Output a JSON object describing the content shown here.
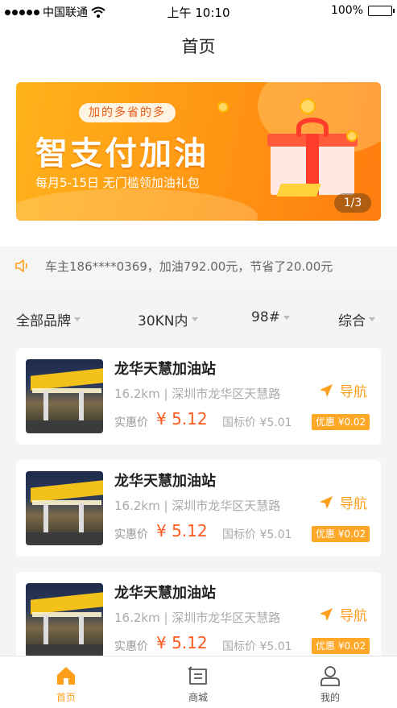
{
  "status_bar": {
    "carrier": "中国联通",
    "time": "上午 10:10",
    "battery": "100%"
  },
  "header": {
    "title": "首页"
  },
  "banner": {
    "tagline": "加的多省的多",
    "headline": "智支付加油",
    "description": "每月5-15日 无门槛领加油礼包",
    "pager": "1/3"
  },
  "notice": {
    "text": "车主186****0369，加油792.00元，节省了20.00元",
    "icon": "speaker-icon"
  },
  "filters": [
    {
      "label": "全部品牌"
    },
    {
      "label": "30KN内"
    },
    {
      "label": "98#"
    },
    {
      "label": "综合"
    }
  ],
  "stations": [
    {
      "name": "龙华天慧加油站",
      "distance": "16.2km",
      "address": "深圳市龙华区天慧路",
      "price_label": "实惠价",
      "price": "¥ 5.12",
      "standard": "国标价 ¥5.01",
      "discount": "优惠 ¥0.02",
      "nav_label": "导航"
    },
    {
      "name": "龙华天慧加油站",
      "distance": "16.2km",
      "address": "深圳市龙华区天慧路",
      "price_label": "实惠价",
      "price": "¥ 5.12",
      "standard": "国标价 ¥5.01",
      "discount": "优惠 ¥0.02",
      "nav_label": "导航"
    },
    {
      "name": "龙华天慧加油站",
      "distance": "16.2km",
      "address": "深圳市龙华区天慧路",
      "price_label": "实惠价",
      "price": "¥ 5.12",
      "standard": "国标价 ¥5.01",
      "discount": "优惠 ¥0.02",
      "nav_label": "导航"
    }
  ],
  "tabs": [
    {
      "label": "首页",
      "icon": "home-icon",
      "active": true
    },
    {
      "label": "商城",
      "icon": "mall-icon",
      "active": false
    },
    {
      "label": "我的",
      "icon": "profile-icon",
      "active": false
    }
  ],
  "colors": {
    "accent": "#ff9e1b",
    "price": "#ff5a1e",
    "inactive": "#666666"
  }
}
